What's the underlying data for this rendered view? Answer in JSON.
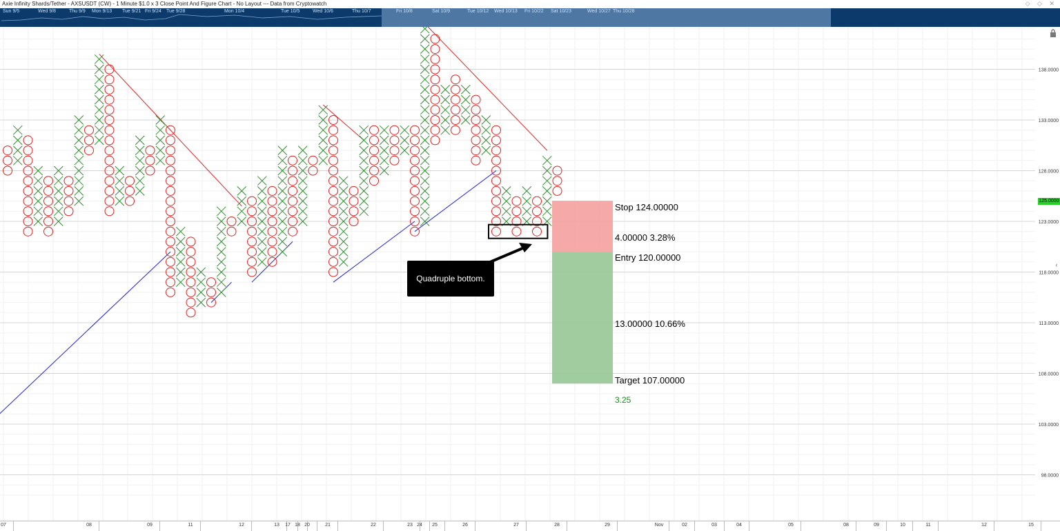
{
  "title": "Axie Infinity Shards/Tether - AXSUSDT (CW) - 1 Minute $1.0 x 3 Close Point And Figure Chart - No Layout --- Data from Cryptowatch",
  "window_controls": "◇ ◇ ✕",
  "overview_dates": [
    "Sun 9/5",
    "Wed 9/8",
    "Thu 9/9",
    "Mon 9/13",
    "Tue 9/21",
    "Fri 9/24",
    "Tue 9/28",
    "Mon 10/4",
    "Tue 10/5",
    "Wed 10/6",
    "Thu 10/7",
    "Fri 10/8",
    "Sat 10/9",
    "Tue 10/12",
    "Wed 10/13",
    "Fri 10/22",
    "Sat 10/23",
    "Wed 10/27",
    "Thu 10/28"
  ],
  "bottom_dates": [
    "07",
    "08",
    "09",
    "11",
    "12",
    "13",
    "17",
    "18",
    "20",
    "21",
    "22",
    "23",
    "24",
    "25",
    "26",
    "27",
    "28",
    "29",
    "Nov",
    "02",
    "03",
    "04",
    "05",
    "08",
    "09",
    "10",
    "11",
    "12",
    "15"
  ],
  "price_tag": "125.0000",
  "callout": "Quadruple bottom.",
  "risk_reward": {
    "stop": "Stop   124.00000",
    "risk": "4.00000   3.28%",
    "entry": "Entry   120.00000",
    "reward": "13.00000   10.66%",
    "target": "Target   107.00000",
    "ratio": "3.25"
  },
  "colors": {
    "x_color": "#2e8b2e",
    "o_color": "#e02020",
    "resistance": "#e02020",
    "support": "#2020e0",
    "stop_zone": "#f4a0a0",
    "target_zone": "#9cc99a"
  },
  "chart_data": {
    "type": "point-and-figure",
    "box_size": 1.0,
    "reversal": 3,
    "y_ticks": [
      "138.0000",
      "133.0000",
      "128.0000",
      "123.0000",
      "118.0000",
      "113.0000",
      "108.0000",
      "103.0000",
      "98.0000"
    ],
    "ylim": [
      94,
      143
    ],
    "columns": [
      {
        "t": "O",
        "low": 128,
        "high": 130
      },
      {
        "t": "X",
        "low": 129,
        "high": 132
      },
      {
        "t": "O",
        "low": 122,
        "high": 131
      },
      {
        "t": "X",
        "low": 123,
        "high": 128
      },
      {
        "t": "O",
        "low": 122,
        "high": 127
      },
      {
        "t": "X",
        "low": 123,
        "high": 128
      },
      {
        "t": "O",
        "low": 124,
        "high": 127
      },
      {
        "t": "X",
        "low": 125,
        "high": 133
      },
      {
        "t": "O",
        "low": 130,
        "high": 132
      },
      {
        "t": "X",
        "low": 131,
        "high": 139
      },
      {
        "t": "O",
        "low": 124,
        "high": 138
      },
      {
        "t": "X",
        "low": 125,
        "high": 128
      },
      {
        "t": "O",
        "low": 125,
        "high": 127
      },
      {
        "t": "X",
        "low": 126,
        "high": 131
      },
      {
        "t": "O",
        "low": 128,
        "high": 130
      },
      {
        "t": "X",
        "low": 129,
        "high": 133
      },
      {
        "t": "O",
        "low": 116,
        "high": 132
      },
      {
        "t": "X",
        "low": 117,
        "high": 122
      },
      {
        "t": "O",
        "low": 114,
        "high": 121
      },
      {
        "t": "X",
        "low": 115,
        "high": 118
      },
      {
        "t": "O",
        "low": 115,
        "high": 117
      },
      {
        "t": "X",
        "low": 116,
        "high": 124
      },
      {
        "t": "O",
        "low": 122,
        "high": 123
      },
      {
        "t": "X",
        "low": 123,
        "high": 126
      },
      {
        "t": "O",
        "low": 118,
        "high": 125
      },
      {
        "t": "X",
        "low": 119,
        "high": 127
      },
      {
        "t": "O",
        "low": 119,
        "high": 126
      },
      {
        "t": "X",
        "low": 120,
        "high": 130
      },
      {
        "t": "O",
        "low": 122,
        "high": 129
      },
      {
        "t": "X",
        "low": 123,
        "high": 130
      },
      {
        "t": "O",
        "low": 128,
        "high": 129
      },
      {
        "t": "X",
        "low": 129,
        "high": 134
      },
      {
        "t": "O",
        "low": 118,
        "high": 133
      },
      {
        "t": "X",
        "low": 119,
        "high": 127
      },
      {
        "t": "O",
        "low": 123,
        "high": 126
      },
      {
        "t": "X",
        "low": 124,
        "high": 132
      },
      {
        "t": "O",
        "low": 127,
        "high": 132
      },
      {
        "t": "X",
        "low": 128,
        "high": 132
      },
      {
        "t": "O",
        "low": 129,
        "high": 132
      },
      {
        "t": "X",
        "low": 130,
        "high": 132
      },
      {
        "t": "O",
        "low": 122,
        "high": 132
      },
      {
        "t": "X",
        "low": 123,
        "high": 142
      },
      {
        "t": "O",
        "low": 131,
        "high": 141
      },
      {
        "t": "X",
        "low": 132,
        "high": 136
      },
      {
        "t": "O",
        "low": 132,
        "high": 137
      },
      {
        "t": "X",
        "low": 133,
        "high": 136
      },
      {
        "t": "O",
        "low": 129,
        "high": 135
      },
      {
        "t": "X",
        "low": 130,
        "high": 133
      },
      {
        "t": "O",
        "low": 122,
        "high": 132
      },
      {
        "t": "X",
        "low": 123,
        "high": 126
      },
      {
        "t": "O",
        "low": 122,
        "high": 125
      },
      {
        "t": "X",
        "low": 123,
        "high": 126
      },
      {
        "t": "O",
        "low": 122,
        "high": 125
      },
      {
        "t": "X",
        "low": 123,
        "high": 129
      },
      {
        "t": "O",
        "low": 126,
        "high": 128
      }
    ],
    "trendlines": [
      {
        "kind": "resistance",
        "from": [
          9,
          139.5
        ],
        "to": [
          23,
          124.5
        ]
      },
      {
        "kind": "resistance",
        "from": [
          31,
          134.5
        ],
        "to": [
          35,
          131
        ]
      },
      {
        "kind": "resistance",
        "from": [
          41,
          142.5
        ],
        "to": [
          53,
          130
        ]
      },
      {
        "kind": "support",
        "from": [
          -0.8,
          104
        ],
        "to": [
          16,
          120
        ]
      },
      {
        "kind": "support",
        "from": [
          20,
          115
        ],
        "to": [
          22,
          117
        ]
      },
      {
        "kind": "support",
        "from": [
          24,
          117
        ],
        "to": [
          28,
          121
        ]
      },
      {
        "kind": "support",
        "from": [
          32,
          117
        ],
        "to": [
          40,
          123
        ]
      },
      {
        "kind": "support",
        "from": [
          40,
          122
        ],
        "to": [
          48,
          128
        ]
      }
    ],
    "pattern_box": {
      "from_col": 48,
      "to_col": 52.3,
      "price": 122
    },
    "position": {
      "stop": 124,
      "entry": 120,
      "target": 107,
      "top": 125,
      "from_col": 53.1
    }
  }
}
